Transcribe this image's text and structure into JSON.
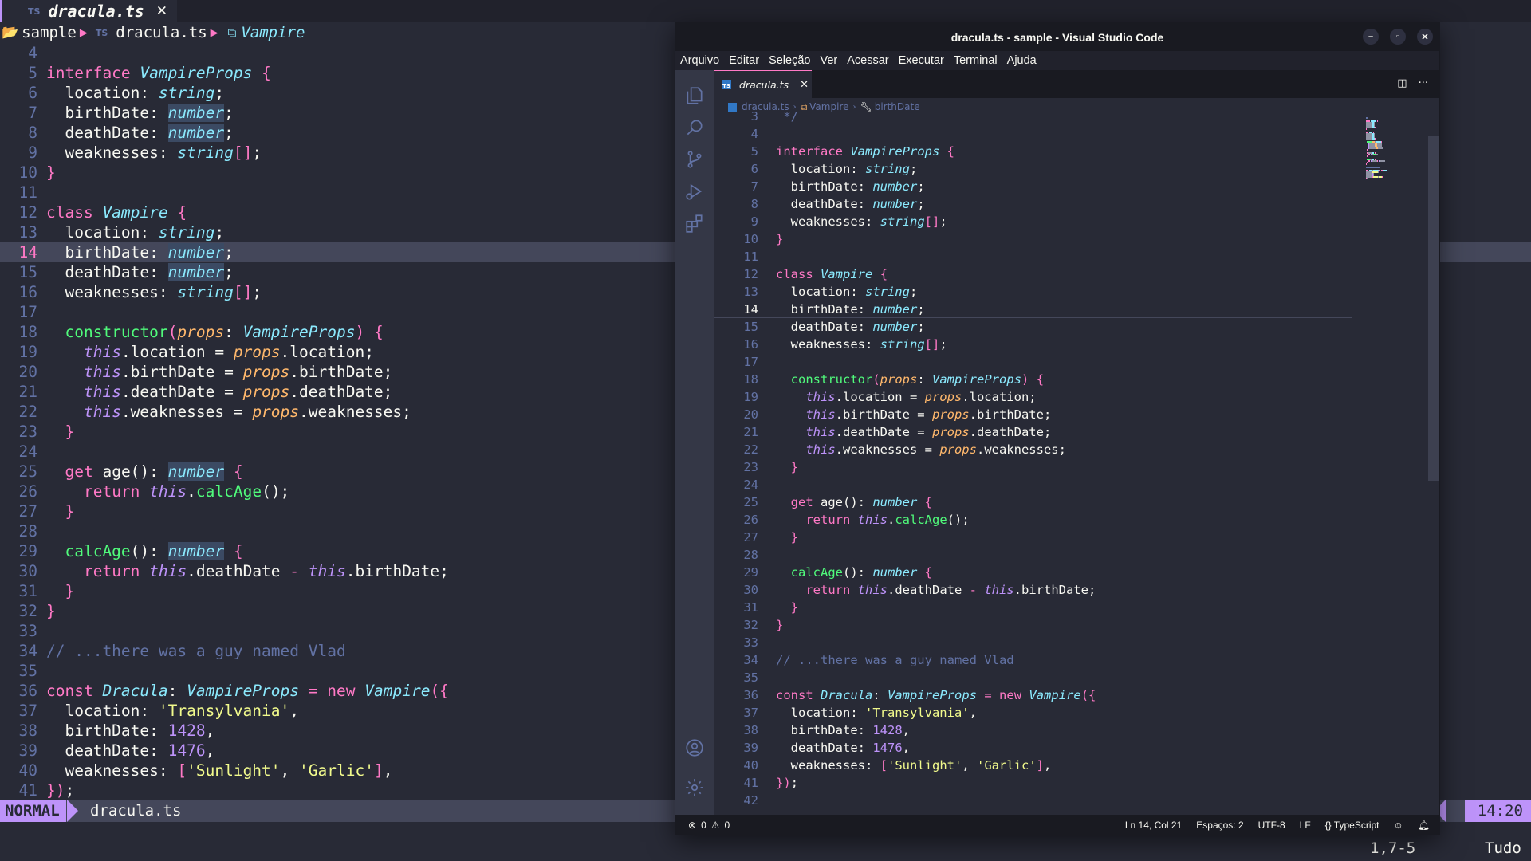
{
  "nvim": {
    "tab": {
      "badge": "TS",
      "name": "dracula.ts",
      "close": "✕"
    },
    "winbar": {
      "folder": "sample",
      "file": "dracula.ts",
      "symbol": "Vampire"
    },
    "status": {
      "mode": "NORMAL",
      "file": "dracula.ts",
      "position": "14:20"
    },
    "cmdline": {
      "cursor": "1,7-5",
      "scroll": "Tudo"
    }
  },
  "vscode": {
    "title": "dracula.ts - sample - Visual Studio Code",
    "menu": [
      "Arquivo",
      "Editar",
      "Seleção",
      "Ver",
      "Acessar",
      "Executar",
      "Terminal",
      "Ajuda"
    ],
    "tab": {
      "name": "dracula.ts"
    },
    "breadcrumb": [
      "dracula.ts",
      "Vampire",
      "birthDate"
    ],
    "status": {
      "errors": "0",
      "warnings": "0",
      "cursor": "Ln 14, Col 21",
      "spaces": "Espaços: 2",
      "encoding": "UTF-8",
      "eol": "LF",
      "language": "TypeScript"
    }
  },
  "colors": {
    "background": "#282a36",
    "keyword": "#ff79c6",
    "type": "#8be9fd",
    "function": "#50fa7b",
    "parameter": "#ffb86c",
    "string": "#f1fa8c",
    "number": "#bd93f9",
    "comment": "#6272a4",
    "accent": "#bd93f9"
  },
  "code": {
    "nvim_start": 4,
    "vscode_start": 3,
    "cursor_line": 14,
    "lines": [
      [
        [
          "c",
          " */"
        ]
      ],
      [],
      [
        [
          "k",
          "interface"
        ],
        [
          "",
          " "
        ],
        [
          "t",
          "VampireProps"
        ],
        [
          "",
          " "
        ],
        [
          "k",
          "{"
        ]
      ],
      [
        [
          "",
          "  location: "
        ],
        [
          "t",
          "string"
        ],
        [
          "",
          ";"
        ]
      ],
      [
        [
          "",
          "  birthDate: "
        ],
        [
          "tb",
          "number"
        ],
        [
          "",
          ";"
        ]
      ],
      [
        [
          "",
          "  deathDate: "
        ],
        [
          "tb",
          "number"
        ],
        [
          "",
          ";"
        ]
      ],
      [
        [
          "",
          "  weaknesses: "
        ],
        [
          "t",
          "string"
        ],
        [
          "k",
          "[]"
        ],
        [
          "",
          ";"
        ]
      ],
      [
        [
          "k",
          "}"
        ]
      ],
      [],
      [
        [
          "k",
          "class"
        ],
        [
          "",
          " "
        ],
        [
          "t",
          "Vampire"
        ],
        [
          "",
          " "
        ],
        [
          "k",
          "{"
        ]
      ],
      [
        [
          "",
          "  location: "
        ],
        [
          "t",
          "string"
        ],
        [
          "",
          ";"
        ]
      ],
      [
        [
          "",
          "  birthDate: "
        ],
        [
          "tb",
          "number"
        ],
        [
          "",
          ";"
        ]
      ],
      [
        [
          "",
          "  deathDate: "
        ],
        [
          "tb",
          "number"
        ],
        [
          "",
          ";"
        ]
      ],
      [
        [
          "",
          "  weaknesses: "
        ],
        [
          "t",
          "string"
        ],
        [
          "k",
          "[]"
        ],
        [
          "",
          ";"
        ]
      ],
      [],
      [
        [
          "",
          "  "
        ],
        [
          "f",
          "constructor"
        ],
        [
          "k",
          "("
        ],
        [
          "p",
          "props"
        ],
        [
          "",
          ": "
        ],
        [
          "t",
          "VampireProps"
        ],
        [
          "k",
          ")"
        ],
        [
          "",
          " "
        ],
        [
          "k",
          "{"
        ]
      ],
      [
        [
          "",
          "    "
        ],
        [
          "th",
          "this"
        ],
        [
          "",
          ".location = "
        ],
        [
          "p",
          "props"
        ],
        [
          "",
          ".location;"
        ]
      ],
      [
        [
          "",
          "    "
        ],
        [
          "th",
          "this"
        ],
        [
          "",
          ".birthDate = "
        ],
        [
          "p",
          "props"
        ],
        [
          "",
          ".birthDate;"
        ]
      ],
      [
        [
          "",
          "    "
        ],
        [
          "th",
          "this"
        ],
        [
          "",
          ".deathDate = "
        ],
        [
          "p",
          "props"
        ],
        [
          "",
          ".deathDate;"
        ]
      ],
      [
        [
          "",
          "    "
        ],
        [
          "th",
          "this"
        ],
        [
          "",
          ".weaknesses = "
        ],
        [
          "p",
          "props"
        ],
        [
          "",
          ".weaknesses;"
        ]
      ],
      [
        [
          "",
          "  "
        ],
        [
          "k",
          "}"
        ]
      ],
      [],
      [
        [
          "",
          "  "
        ],
        [
          "k",
          "get"
        ],
        [
          "",
          " age(): "
        ],
        [
          "tb",
          "number"
        ],
        [
          "",
          " "
        ],
        [
          "k",
          "{"
        ]
      ],
      [
        [
          "",
          "    "
        ],
        [
          "k",
          "return"
        ],
        [
          "",
          " "
        ],
        [
          "th",
          "this"
        ],
        [
          "",
          "."
        ],
        [
          "f",
          "calcAge"
        ],
        [
          "",
          "();"
        ]
      ],
      [
        [
          "",
          "  "
        ],
        [
          "k",
          "}"
        ]
      ],
      [],
      [
        [
          "",
          "  "
        ],
        [
          "f",
          "calcAge"
        ],
        [
          "",
          "(): "
        ],
        [
          "tb",
          "number"
        ],
        [
          "",
          " "
        ],
        [
          "k",
          "{"
        ]
      ],
      [
        [
          "",
          "    "
        ],
        [
          "k",
          "return"
        ],
        [
          "",
          " "
        ],
        [
          "th",
          "this"
        ],
        [
          "",
          ".deathDate "
        ],
        [
          "k",
          "-"
        ],
        [
          "",
          " "
        ],
        [
          "th",
          "this"
        ],
        [
          "",
          ".birthDate;"
        ]
      ],
      [
        [
          "",
          "  "
        ],
        [
          "k",
          "}"
        ]
      ],
      [
        [
          "k",
          "}"
        ]
      ],
      [],
      [
        [
          "c",
          "// ...there was a guy named Vlad"
        ]
      ],
      [],
      [
        [
          "k",
          "const"
        ],
        [
          "",
          " "
        ],
        [
          "t",
          "Dracula"
        ],
        [
          "",
          ": "
        ],
        [
          "t",
          "VampireProps"
        ],
        [
          "",
          " "
        ],
        [
          "k",
          "="
        ],
        [
          "",
          " "
        ],
        [
          "k",
          "new"
        ],
        [
          "",
          " "
        ],
        [
          "t",
          "Vampire"
        ],
        [
          "k",
          "({"
        ]
      ],
      [
        [
          "",
          "  location: "
        ],
        [
          "s",
          "'Transylvania'"
        ],
        [
          "",
          ","
        ]
      ],
      [
        [
          "",
          "  birthDate: "
        ],
        [
          "n",
          "1428"
        ],
        [
          "",
          ","
        ]
      ],
      [
        [
          "",
          "  deathDate: "
        ],
        [
          "n",
          "1476"
        ],
        [
          "",
          ","
        ]
      ],
      [
        [
          "",
          "  weaknesses: "
        ],
        [
          "k",
          "["
        ],
        [
          "s",
          "'Sunlight'"
        ],
        [
          "",
          ", "
        ],
        [
          "s",
          "'Garlic'"
        ],
        [
          "k",
          "]"
        ],
        [
          "",
          ","
        ]
      ],
      [
        [
          "k",
          "})"
        ],
        [
          "",
          ";"
        ]
      ],
      []
    ]
  }
}
